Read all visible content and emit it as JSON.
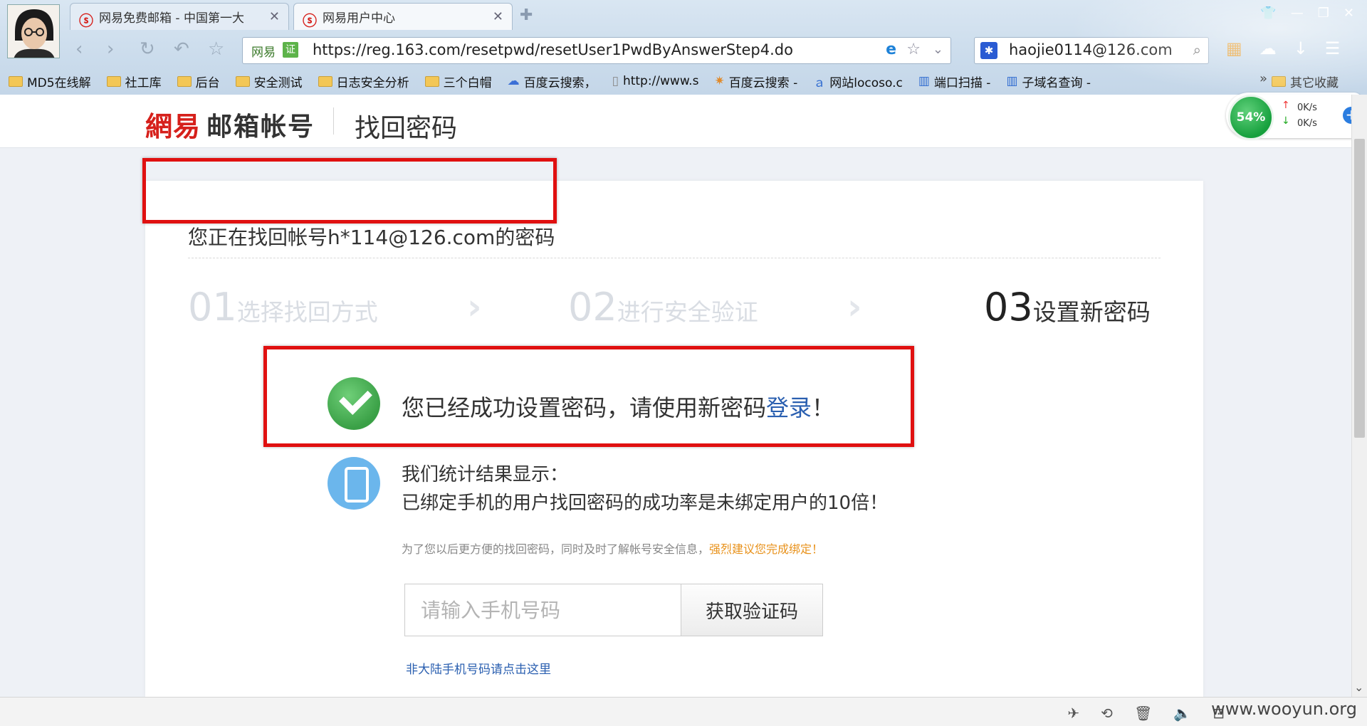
{
  "browser": {
    "tabs": [
      {
        "label": "网易免费邮箱 - 中国第一大",
        "active": false
      },
      {
        "label": "网易用户中心",
        "active": true
      }
    ],
    "address": {
      "site_label": "网易",
      "cert_label": "证",
      "url": "https://reg.163.com/resetpwd/resetUser1PwdByAnswerStep4.do"
    },
    "search": {
      "query": "haojie0114@126.com"
    },
    "bookmarks": [
      {
        "label": "MD5在线解",
        "icon": "folder-icon"
      },
      {
        "label": "社工库",
        "icon": "folder-icon"
      },
      {
        "label": "后台",
        "icon": "folder-icon"
      },
      {
        "label": "安全测试",
        "icon": "folder-icon"
      },
      {
        "label": "日志安全分析",
        "icon": "folder-icon"
      },
      {
        "label": "三个白帽",
        "icon": "folder-icon"
      },
      {
        "label": "百度云搜索，",
        "icon": "cloud-search-icon"
      },
      {
        "label": "http://www.s",
        "icon": "page-icon"
      },
      {
        "label": "百度云搜索 -",
        "icon": "puzzle-icon"
      },
      {
        "label": "网站locoso.c",
        "icon": "site-icon"
      },
      {
        "label": "端口扫描 -",
        "icon": "scan-icon"
      },
      {
        "label": "子域名查询 -",
        "icon": "scan-icon"
      }
    ],
    "bookmarks_more": "»",
    "bookmarks_other": "其它收藏"
  },
  "speed_widget": {
    "percent": "54%",
    "up": "0K/s",
    "down": "0K/s"
  },
  "header": {
    "logo": "網易",
    "logo_sub": "邮箱帐号",
    "title": "找回密码"
  },
  "main": {
    "account_line": "您正在找回帐号h*114@126.com的密码",
    "steps": [
      {
        "num": "01",
        "label": "选择找回方式",
        "state": "done"
      },
      {
        "num": "02",
        "label": "进行安全验证",
        "state": "done"
      },
      {
        "num": "03",
        "label": "设置新密码",
        "state": "active"
      }
    ],
    "success_prefix": "您已经成功设置密码，请使用新密码",
    "success_link": "登录",
    "success_suffix": "！",
    "stat_line1": "我们统计结果显示：",
    "stat_line2": "已绑定手机的用户找回密码的成功率是未绑定用户的10倍！",
    "tip_text": "为了您以后更方便的找回密码，同时及时了解帐号安全信息，",
    "tip_warn": "强烈建议您完成绑定！",
    "phone_placeholder": "请输入手机号码",
    "get_code_label": "获取验证码",
    "non_mainland_link": "非大陆手机号码请点击这里"
  },
  "statusbar": {
    "watermark": "www.wooyun.org"
  },
  "colors": {
    "accent_red": "#d6201b",
    "link_blue": "#2a5fb0",
    "warn_orange": "#e8911a",
    "success_green": "#3aa046"
  }
}
